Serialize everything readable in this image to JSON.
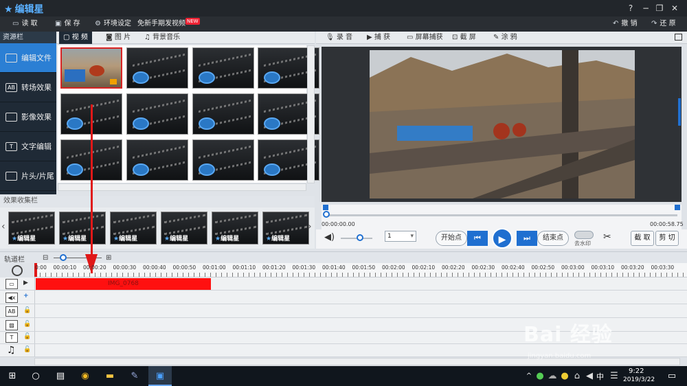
{
  "app": {
    "name": "编辑星"
  },
  "window_controls": [
    "?",
    "−",
    "❐",
    "✕"
  ],
  "menu": {
    "open": "读 取",
    "save": "保 存",
    "env": "环境设定",
    "free_video": "免新手期发视频",
    "new_badge": "NEW",
    "undo": "撤 销",
    "redo": "还 原"
  },
  "sidebar": {
    "title": "资源栏",
    "items": [
      {
        "label": "编辑文件",
        "icon": "film-icon"
      },
      {
        "label": "转场效果",
        "icon": "ab-icon"
      },
      {
        "label": "影像效果",
        "icon": "image-effect-icon"
      },
      {
        "label": "文字编辑",
        "icon": "text-icon"
      },
      {
        "label": "片头/片尾",
        "icon": "titles-icon"
      }
    ]
  },
  "media_tabs": {
    "video": "视 频",
    "photo": "图 片",
    "music": "背景音乐"
  },
  "effects_bar": {
    "title": "效果收集栏",
    "item_label_star": "★",
    "item_label": "编辑星"
  },
  "preview_tabs": {
    "record": "录 音",
    "capture": "捕 获",
    "screen_capture": "屏幕捕获",
    "screenshot": "截 屏",
    "doodle": "涂 鸦"
  },
  "scrubber": {
    "start_time": "00:00:00.00",
    "end_time": "00:00:58.75",
    "position_fraction": 0.0
  },
  "controls": {
    "speed_value": "1",
    "start_point": "开始点",
    "end_point": "结束点",
    "watermark_toggle": "去水印",
    "cut": "截 取",
    "trim": "剪 切",
    "volume_fraction": 0.6
  },
  "timeline": {
    "title": "轨道栏",
    "zoom_fraction": 0.2,
    "ticks": [
      "0:00",
      "00:00:10",
      "00:00:20",
      "00:00:30",
      "00:00:40",
      "00:00:50",
      "00:01:00",
      "00:01:10",
      "00:01:20",
      "00:01:30",
      "00:01:40",
      "00:01:50",
      "00:02:00",
      "00:02:10",
      "00:02:20",
      "00:02:30",
      "00:02:40",
      "00:02:50",
      "00:03:00",
      "00:03:10",
      "00:03:20",
      "00:03:30"
    ],
    "clip_name": "IMG_0768"
  },
  "taskbar": {
    "time": "9:22",
    "date": "2019/3/22",
    "ime": "中"
  },
  "watermark": {
    "text": "Bai 经验",
    "url": "jingyan.baidu.com"
  },
  "colors": {
    "accent": "#2b7fd4",
    "clip": "#ff1010",
    "arrow": "#e01818",
    "titlebar": "#22262b"
  }
}
